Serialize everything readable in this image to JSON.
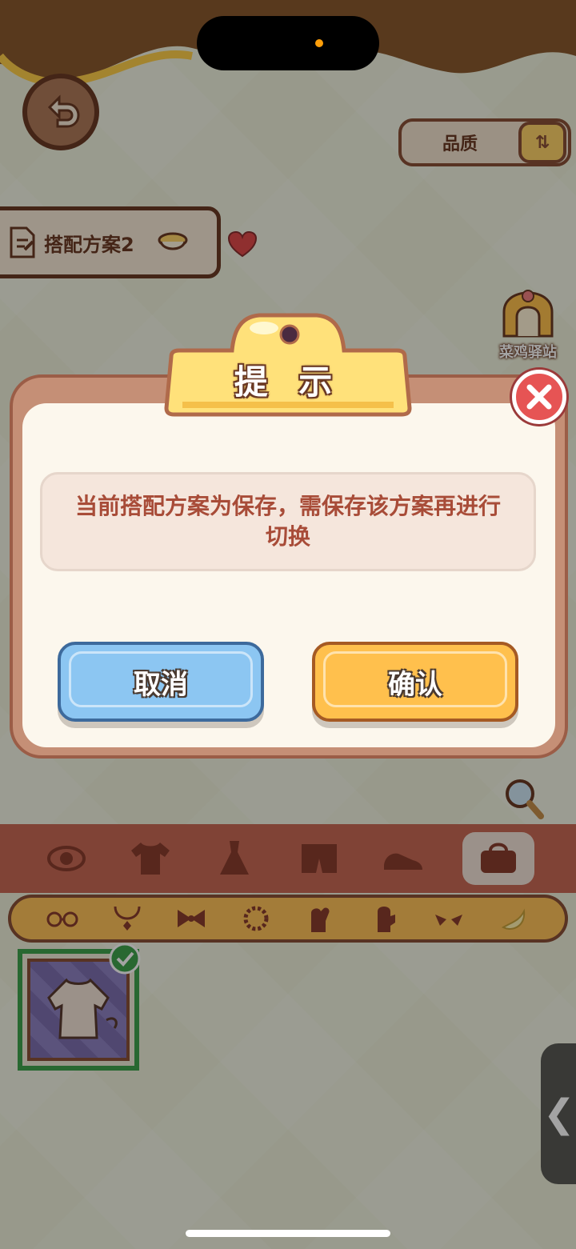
{
  "top_bar": {
    "quality_label": "品质",
    "sort_icon": "sort-toggle-icon"
  },
  "plan": {
    "name": "搭配方案2"
  },
  "station": {
    "label": "菜鸡驿站"
  },
  "dialog": {
    "title": "提 示",
    "message": "当前搭配方案为保存，需保存该方案再进行切换",
    "cancel_label": "取消",
    "confirm_label": "确认"
  },
  "categories": [
    "eye-icon",
    "shirt-icon",
    "dress-icon",
    "shorts-icon",
    "shoes-icon",
    "bag-icon"
  ],
  "subcategories": [
    "glasses-icon",
    "necklace-icon",
    "bow-icon",
    "bracelet-icon",
    "glove-icon",
    "mitten-icon",
    "wings-icon",
    "tail-icon"
  ],
  "colors": {
    "accent_orange": "#ffc04d",
    "accent_blue": "#8cc6f2",
    "brown": "#6b3a25",
    "message_text": "#a84c38"
  }
}
